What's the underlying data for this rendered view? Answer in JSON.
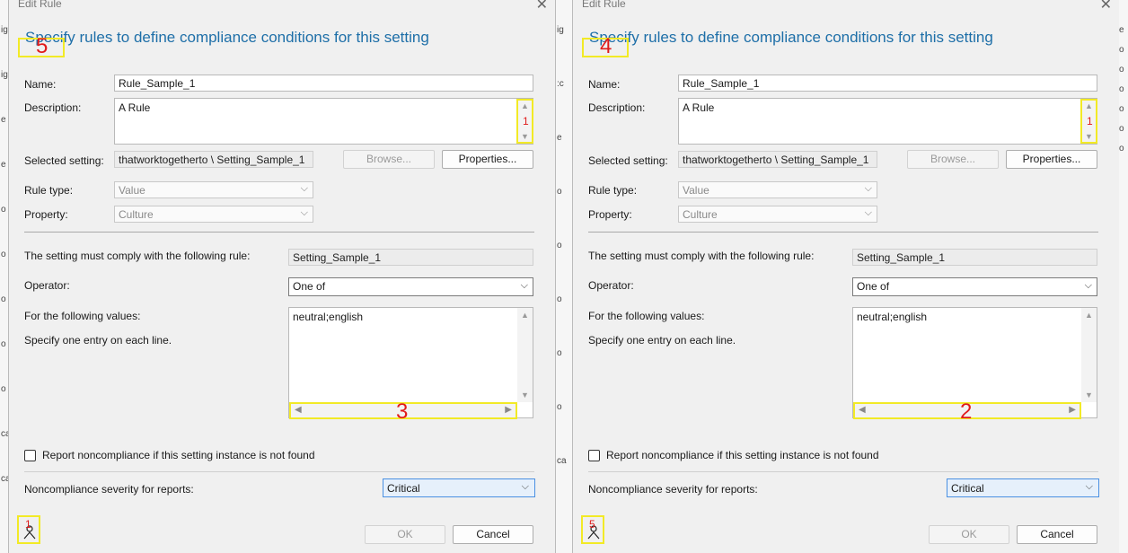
{
  "background": {
    "left_marks": [
      "ig",
      "ig",
      "e",
      "e",
      "o",
      "o",
      "o",
      "o",
      "o",
      "ca",
      "ca"
    ],
    "middle_marks": [
      "ig",
      ":c",
      "e",
      "o",
      "o",
      "o",
      "o",
      "o",
      "ca"
    ],
    "right_marks": [
      "e",
      "o",
      "o",
      "o",
      "o",
      "o",
      "o"
    ]
  },
  "panels": [
    {
      "window_title": "Edit Rule",
      "heading": "Specify rules to define compliance conditions for this setting",
      "name_label": "Name:",
      "name_value": "Rule_Sample_1",
      "description_label": "Description:",
      "description_value": "A Rule",
      "selected_setting_label": "Selected setting:",
      "selected_setting_value": "thatworktogetherto \\ Setting_Sample_1",
      "browse_label": "Browse...",
      "properties_label": "Properties...",
      "rule_type_label": "Rule type:",
      "rule_type_value": "Value",
      "property_label": "Property:",
      "property_value": "Culture",
      "comply_label": "The setting must comply with the following rule:",
      "comply_value": "Setting_Sample_1",
      "operator_label": "Operator:",
      "operator_value": "One of",
      "values_label": "For the following values:",
      "values_hint": "Specify one entry on each line.",
      "values_value": "neutral;english",
      "report_label": "Report noncompliance if this setting instance is not found",
      "severity_label": "Noncompliance severity for reports:",
      "severity_value": "Critical",
      "ok_label": "OK",
      "cancel_label": "Cancel",
      "annotations": {
        "heading": "5",
        "desc_scroll": "1",
        "hscroll": "3",
        "footer": "1"
      }
    },
    {
      "window_title": "Edit Rule",
      "heading": "Specify rules to define compliance conditions for this setting",
      "name_label": "Name:",
      "name_value": "Rule_Sample_1",
      "description_label": "Description:",
      "description_value": "A Rule",
      "selected_setting_label": "Selected setting:",
      "selected_setting_value": "thatworktogetherto \\ Setting_Sample_1",
      "browse_label": "Browse...",
      "properties_label": "Properties...",
      "rule_type_label": "Rule type:",
      "rule_type_value": "Value",
      "property_label": "Property:",
      "property_value": "Culture",
      "comply_label": "The setting must comply with the following rule:",
      "comply_value": "Setting_Sample_1",
      "operator_label": "Operator:",
      "operator_value": "One of",
      "values_label": "For the following values:",
      "values_hint": "Specify one entry on each line.",
      "values_value": "neutral;english",
      "report_label": "Report noncompliance if this setting instance is not found",
      "severity_label": "Noncompliance severity for reports:",
      "severity_value": "Critical",
      "ok_label": "OK",
      "cancel_label": "Cancel",
      "annotations": {
        "heading": "4",
        "desc_scroll": "1",
        "hscroll": "2",
        "footer": "5"
      }
    }
  ]
}
